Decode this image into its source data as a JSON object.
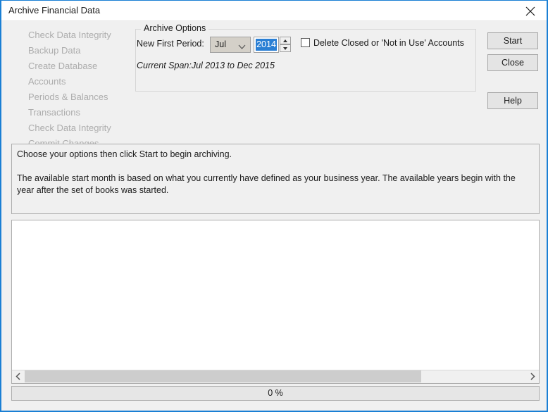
{
  "window": {
    "title": "Archive Financial Data",
    "close_icon": "close-x-icon",
    "border_color": "#1a7fd4"
  },
  "steps": [
    {
      "label": "Check Data Integrity"
    },
    {
      "label": "Backup Data"
    },
    {
      "label": "Create Database"
    },
    {
      "label": "Accounts"
    },
    {
      "label": "Periods & Balances"
    },
    {
      "label": "Transactions"
    },
    {
      "label": "Check Data Integrity"
    },
    {
      "label": "Commit Changes"
    }
  ],
  "archive_options": {
    "group_title": "Archive Options",
    "period_label": "New First Period:",
    "month": {
      "value": "Jul",
      "arrow_icon": "chevron-down-icon"
    },
    "year": {
      "value": "2014",
      "selected": true,
      "selection_color": "#2a7fd4",
      "spinner_up_icon": "triangle-up-icon",
      "spinner_down_icon": "triangle-down-icon"
    },
    "delete_accounts": {
      "label": "Delete Closed or 'Not in Use' Accounts",
      "checked": false
    },
    "current_span": "Current Span:Jul 2013 to Dec 2015"
  },
  "buttons": {
    "start": "Start",
    "close": "Close",
    "help": "Help"
  },
  "info": {
    "line1": "Choose your options then click Start to begin archiving.",
    "line2": "The available start month is based on what you currently have defined as your business year. The available years begin with the year after the set of books was started."
  },
  "output": {
    "content": "",
    "scrollbar": {
      "left_arrow_icon": "chevron-left-icon",
      "right_arrow_icon": "chevron-right-icon"
    }
  },
  "progress": {
    "text": "0 %",
    "percent": 0
  }
}
